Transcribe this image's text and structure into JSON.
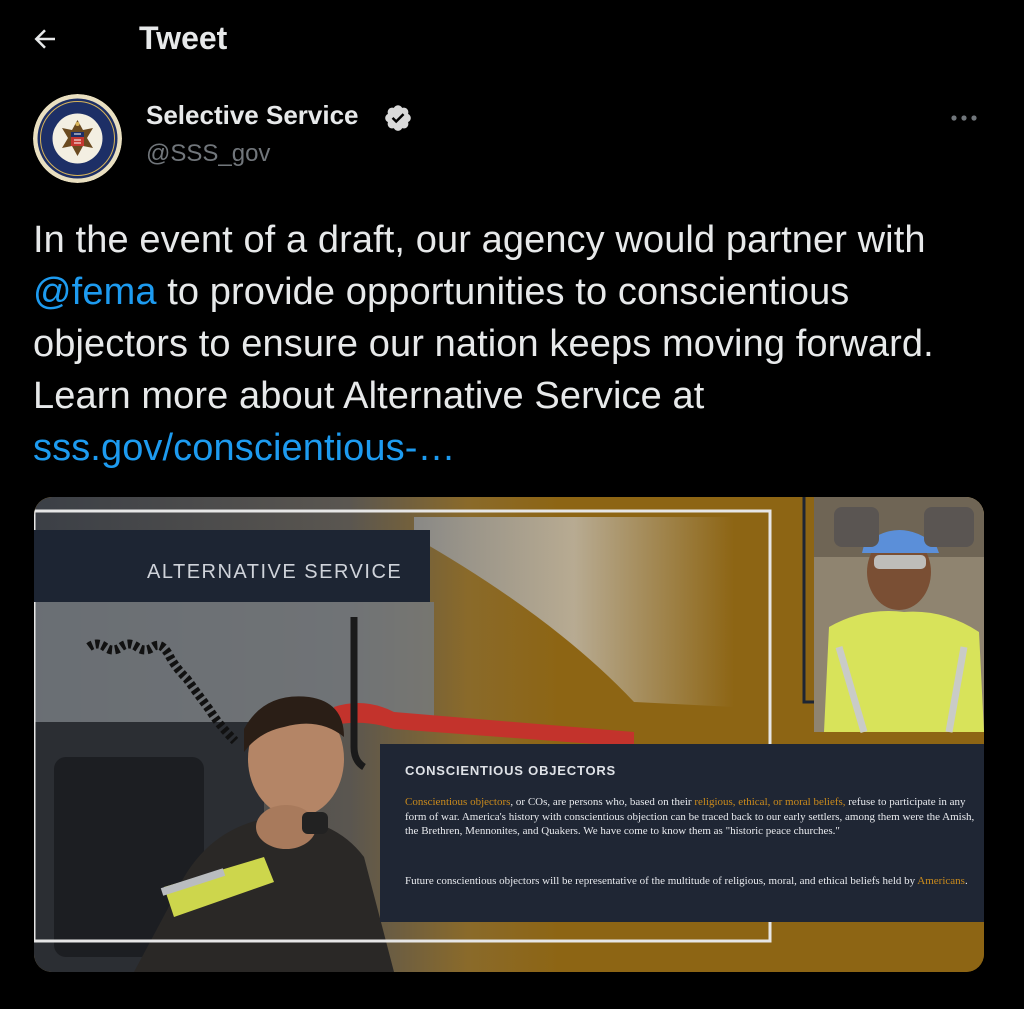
{
  "header": {
    "title": "Tweet"
  },
  "author": {
    "name": "Selective Service",
    "handle": "@SSS_gov",
    "avatar_text": "SELECTIVE SERVICE SYSTEM"
  },
  "tweet": {
    "text_part1": "In the event of a draft, our agency would partner with ",
    "mention": "@fema",
    "text_part2": " to provide opportunities to conscientious objectors to ensure our nation keeps moving forward. Learn more about Alternative Service at ",
    "link": "sss.gov/conscientious-…"
  },
  "media": {
    "banner_title": "ALTERNATIVE SERVICE",
    "box_title": "CONSCIENTIOUS OBJECTORS",
    "para1_hl1": "Conscientious objectors",
    "para1_a": ", or COs, are persons who, based on their ",
    "para1_hl2": "religious, ethical, or moral beliefs,",
    "para1_b": " refuse to participate in any form of war.  America's history with conscientious objection can be traced back to our early settlers, among them were the Amish, the Brethren, Mennonites, and Quakers. We have come to know them as \"historic peace churches.\"",
    "para2_a": "Future conscientious objectors will be representative of the multitude of religious, moral, and ethical beliefs held by ",
    "para2_hl": "Americans",
    "para2_b": "."
  },
  "colors": {
    "background": "#000000",
    "text": "#e7e9ea",
    "secondary": "#71767b",
    "link": "#1d9bf0",
    "verified": "#d9d9d9",
    "media_gold": "#8d6514",
    "media_navy": "#1f2634"
  },
  "icons": {
    "back": "arrow-left-icon",
    "verified": "verified-badge-icon",
    "more": "more-horizontal-icon"
  }
}
